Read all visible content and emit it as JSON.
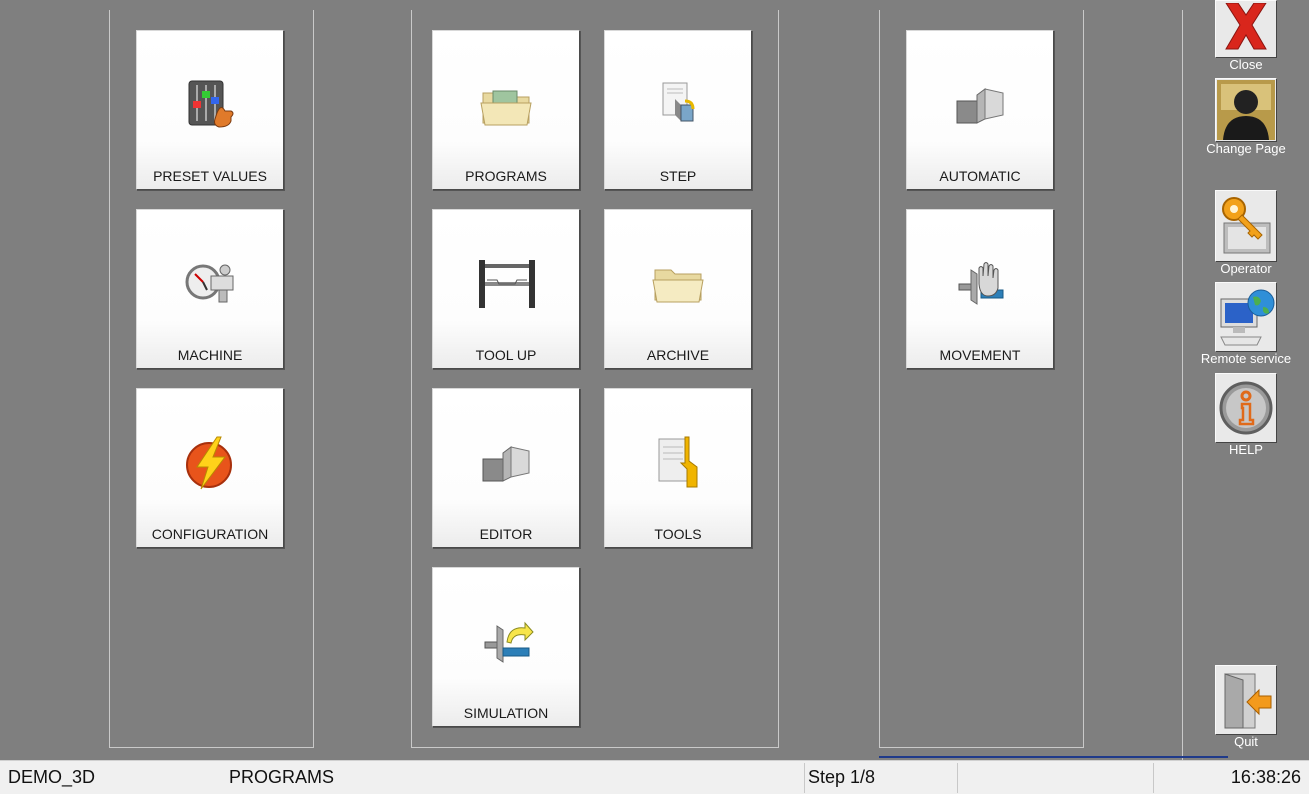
{
  "tiles": {
    "preset_values": "PRESET VALUES",
    "machine": "MACHINE",
    "configuration": "CONFIGURATION",
    "programs": "PROGRAMS",
    "step": "STEP",
    "tool_up": "TOOL UP",
    "archive": "ARCHIVE",
    "editor": "EDITOR",
    "tools": "TOOLS",
    "simulation": "SIMULATION",
    "automatic": "AUTOMATIC",
    "movement": "MOVEMENT"
  },
  "sidebar": {
    "close": "Close",
    "change_page": "Change Page",
    "operator": "Operator",
    "remote_service": "Remote service",
    "help": "HELP",
    "quit": "Quit"
  },
  "status": {
    "program_name": "DEMO_3D",
    "page": "PROGRAMS",
    "step": "Step 1/8",
    "time": "16:38:26"
  },
  "icons": {
    "preset_values": "sliders-thumb-icon",
    "machine": "stopwatch-gauge-icon",
    "configuration": "lightning-ball-icon",
    "programs": "open-folder-icon",
    "step": "document-bend-icon",
    "tool_up": "press-tool-icon",
    "archive": "archive-folder-icon",
    "editor": "bent-sheet-icon",
    "tools": "tool-list-icon",
    "simulation": "simulation-arrow-icon",
    "automatic": "bent-sheet-icon",
    "movement": "hand-movement-icon"
  },
  "colors": {
    "background": "#7f7f7f",
    "tile": "#ffffff",
    "statusbar": "#f0f0f0",
    "progress_line": "#1f3a8a"
  }
}
